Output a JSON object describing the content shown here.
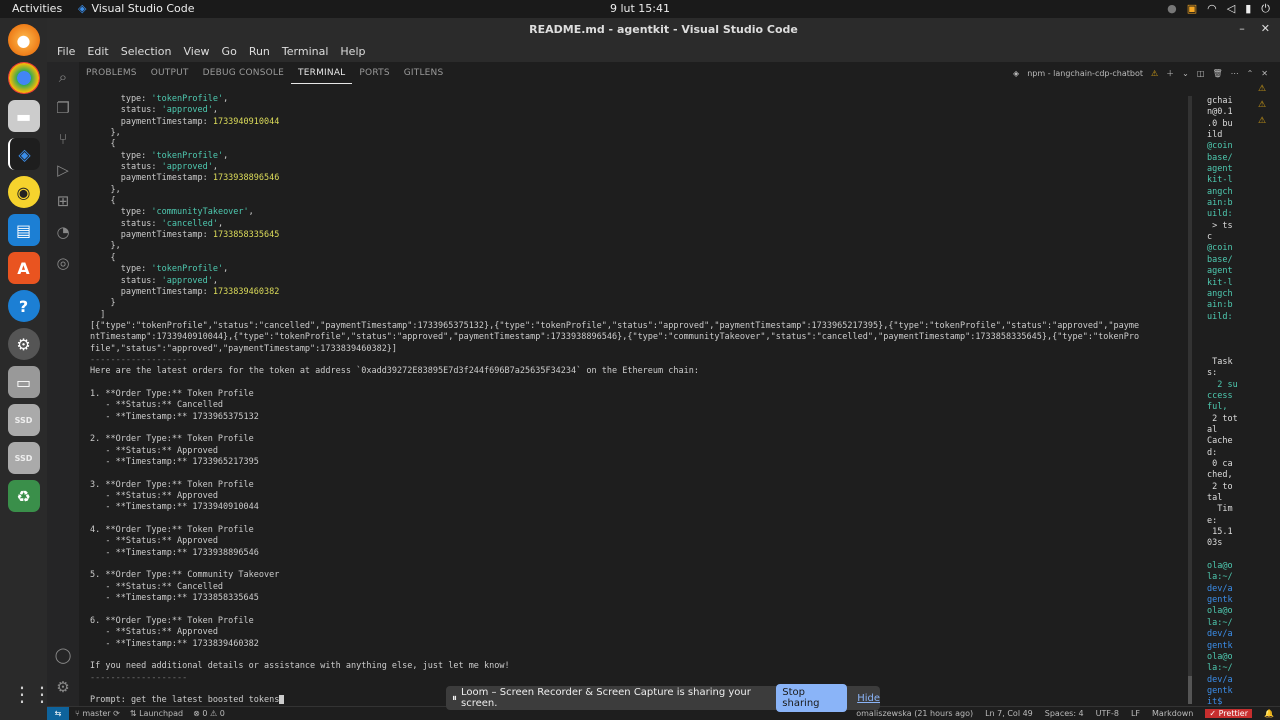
{
  "topbar": {
    "activities": "Activities",
    "app_name": "Visual Studio Code",
    "clock": "9 lut  15:41"
  },
  "window": {
    "title": "README.md - agentkit - Visual Studio Code"
  },
  "menu": [
    "File",
    "Edit",
    "Selection",
    "View",
    "Go",
    "Run",
    "Terminal",
    "Help"
  ],
  "panel": {
    "tabs": [
      "PROBLEMS",
      "OUTPUT",
      "DEBUG CONSOLE",
      "TERMINAL",
      "PORTS",
      "GITLENS"
    ],
    "active_tab": "TERMINAL",
    "terminal_name": "npm - langchain-cdp-chatbot"
  },
  "terminal": {
    "lines": [
      [
        {
          "t": "      type: "
        },
        {
          "t": "'tokenProfile'",
          "c": "str"
        },
        {
          "t": ","
        }
      ],
      [
        {
          "t": "      status: "
        },
        {
          "t": "'approved'",
          "c": "str"
        },
        {
          "t": ","
        }
      ],
      [
        {
          "t": "      paymentTimestamp: "
        },
        {
          "t": "1733940910044",
          "c": "num"
        }
      ],
      [
        {
          "t": "    },"
        }
      ],
      [
        {
          "t": "    {"
        }
      ],
      [
        {
          "t": "      type: "
        },
        {
          "t": "'tokenProfile'",
          "c": "str"
        },
        {
          "t": ","
        }
      ],
      [
        {
          "t": "      status: "
        },
        {
          "t": "'approved'",
          "c": "str"
        },
        {
          "t": ","
        }
      ],
      [
        {
          "t": "      paymentTimestamp: "
        },
        {
          "t": "1733938896546",
          "c": "num"
        }
      ],
      [
        {
          "t": "    },"
        }
      ],
      [
        {
          "t": "    {"
        }
      ],
      [
        {
          "t": "      type: "
        },
        {
          "t": "'communityTakeover'",
          "c": "str"
        },
        {
          "t": ","
        }
      ],
      [
        {
          "t": "      status: "
        },
        {
          "t": "'cancelled'",
          "c": "str"
        },
        {
          "t": ","
        }
      ],
      [
        {
          "t": "      paymentTimestamp: "
        },
        {
          "t": "1733858335645",
          "c": "num"
        }
      ],
      [
        {
          "t": "    },"
        }
      ],
      [
        {
          "t": "    {"
        }
      ],
      [
        {
          "t": "      type: "
        },
        {
          "t": "'tokenProfile'",
          "c": "str"
        },
        {
          "t": ","
        }
      ],
      [
        {
          "t": "      status: "
        },
        {
          "t": "'approved'",
          "c": "str"
        },
        {
          "t": ","
        }
      ],
      [
        {
          "t": "      paymentTimestamp: "
        },
        {
          "t": "1733839460382",
          "c": "num"
        }
      ],
      [
        {
          "t": "    }"
        }
      ],
      [
        {
          "t": "  ]"
        }
      ],
      [
        {
          "t": "[{\"type\":\"tokenProfile\",\"status\":\"cancelled\",\"paymentTimestamp\":1733965375132},{\"type\":\"tokenProfile\",\"status\":\"approved\",\"paymentTimestamp\":1733965217395},{\"type\":\"tokenProfile\",\"status\":\"approved\",\"payme"
        }
      ],
      [
        {
          "t": "ntTimestamp\":1733940910044},{\"type\":\"tokenProfile\",\"status\":\"approved\",\"paymentTimestamp\":1733938896546},{\"type\":\"communityTakeover\",\"status\":\"cancelled\",\"paymentTimestamp\":1733858335645},{\"type\":\"tokenPro"
        }
      ],
      [
        {
          "t": "file\",\"status\":\"approved\",\"paymentTimestamp\":1733839460382}]"
        }
      ],
      [
        {
          "t": "-------------------",
          "c": "dim"
        }
      ],
      [
        {
          "t": "Here are the latest orders for the token at address `0xadd39272E83895E7d3f244f696B7a25635F34234` on the Ethereum chain:"
        }
      ],
      [
        {
          "t": ""
        }
      ],
      [
        {
          "t": "1. **Order Type:** Token Profile"
        }
      ],
      [
        {
          "t": "   - **Status:** Cancelled"
        }
      ],
      [
        {
          "t": "   - **Timestamp:** 1733965375132"
        }
      ],
      [
        {
          "t": ""
        }
      ],
      [
        {
          "t": "2. **Order Type:** Token Profile"
        }
      ],
      [
        {
          "t": "   - **Status:** Approved"
        }
      ],
      [
        {
          "t": "   - **Timestamp:** 1733965217395"
        }
      ],
      [
        {
          "t": ""
        }
      ],
      [
        {
          "t": "3. **Order Type:** Token Profile"
        }
      ],
      [
        {
          "t": "   - **Status:** Approved"
        }
      ],
      [
        {
          "t": "   - **Timestamp:** 1733940910044"
        }
      ],
      [
        {
          "t": ""
        }
      ],
      [
        {
          "t": "4. **Order Type:** Token Profile"
        }
      ],
      [
        {
          "t": "   - **Status:** Approved"
        }
      ],
      [
        {
          "t": "   - **Timestamp:** 1733938896546"
        }
      ],
      [
        {
          "t": ""
        }
      ],
      [
        {
          "t": "5. **Order Type:** Community Takeover"
        }
      ],
      [
        {
          "t": "   - **Status:** Cancelled"
        }
      ],
      [
        {
          "t": "   - **Timestamp:** 1733858335645"
        }
      ],
      [
        {
          "t": ""
        }
      ],
      [
        {
          "t": "6. **Order Type:** Token Profile"
        }
      ],
      [
        {
          "t": "   - **Status:** Approved"
        }
      ],
      [
        {
          "t": "   - **Timestamp:** 1733839460382"
        }
      ],
      [
        {
          "t": ""
        }
      ],
      [
        {
          "t": "If you need additional details or assistance with anything else, just let me know!"
        }
      ],
      [
        {
          "t": "-------------------",
          "c": "dim"
        }
      ],
      [
        {
          "t": ""
        }
      ],
      [
        {
          "t": "Prompt: get the latest boosted tokens"
        }
      ]
    ]
  },
  "side_terminal": {
    "lines": [
      [
        {
          "t": "gchai",
          "c": "w"
        }
      ],
      [
        {
          "t": "n@0.1",
          "c": "w"
        }
      ],
      [
        {
          "t": ".0 bu",
          "c": "w"
        }
      ],
      [
        {
          "t": "ild",
          "c": "w"
        }
      ],
      [
        {
          "t": "@coin",
          "c": "c"
        }
      ],
      [
        {
          "t": "base/",
          "c": "c"
        }
      ],
      [
        {
          "t": "agent",
          "c": "c"
        }
      ],
      [
        {
          "t": "kit-l",
          "c": "c"
        }
      ],
      [
        {
          "t": "angch",
          "c": "c"
        }
      ],
      [
        {
          "t": "ain:b",
          "c": "c"
        }
      ],
      [
        {
          "t": "uild:",
          "c": "c"
        }
      ],
      [
        {
          "t": " > ts",
          "c": "w"
        }
      ],
      [
        {
          "t": "c",
          "c": "w"
        }
      ],
      [
        {
          "t": "@coin",
          "c": "c"
        }
      ],
      [
        {
          "t": "base/",
          "c": "c"
        }
      ],
      [
        {
          "t": "agent",
          "c": "c"
        }
      ],
      [
        {
          "t": "kit-l",
          "c": "c"
        }
      ],
      [
        {
          "t": "angch",
          "c": "c"
        }
      ],
      [
        {
          "t": "ain:b",
          "c": "c"
        }
      ],
      [
        {
          "t": "uild:",
          "c": "c"
        }
      ],
      [
        {
          "t": "",
          "c": "w"
        }
      ],
      [
        {
          "t": "",
          "c": "w"
        }
      ],
      [
        {
          "t": "",
          "c": "w"
        }
      ],
      [
        {
          "t": " Task",
          "c": "w"
        }
      ],
      [
        {
          "t": "s:",
          "c": "w"
        }
      ],
      [
        {
          "t": "  2 su",
          "c": "g"
        }
      ],
      [
        {
          "t": "ccess",
          "c": "g"
        }
      ],
      [
        {
          "t": "ful,",
          "c": "g"
        }
      ],
      [
        {
          "t": " 2 tot",
          "c": "w"
        }
      ],
      [
        {
          "t": "al",
          "c": "w"
        }
      ],
      [
        {
          "t": "Cache",
          "c": "w"
        }
      ],
      [
        {
          "t": "d:",
          "c": "w"
        }
      ],
      [
        {
          "t": " 0 ca",
          "c": "w"
        }
      ],
      [
        {
          "t": "ched,",
          "c": "w"
        }
      ],
      [
        {
          "t": " 2 to",
          "c": "w"
        }
      ],
      [
        {
          "t": "tal",
          "c": "w"
        }
      ],
      [
        {
          "t": "  Tim",
          "c": "w"
        }
      ],
      [
        {
          "t": "e:",
          "c": "w"
        }
      ],
      [
        {
          "t": " 15.1",
          "c": "w"
        }
      ],
      [
        {
          "t": "03s",
          "c": "w"
        }
      ],
      [
        {
          "t": "",
          "c": "w"
        }
      ],
      [
        {
          "t": "ola@o",
          "c": "g"
        }
      ],
      [
        {
          "t": "la:~/",
          "c": "g"
        }
      ],
      [
        {
          "t": "dev/a",
          "c": "b"
        }
      ],
      [
        {
          "t": "gentk",
          "c": "b"
        }
      ],
      [
        {
          "t": "ola@o",
          "c": "g"
        }
      ],
      [
        {
          "t": "la:~/",
          "c": "g"
        }
      ],
      [
        {
          "t": "dev/a",
          "c": "b"
        }
      ],
      [
        {
          "t": "gentk",
          "c": "b"
        }
      ],
      [
        {
          "t": "ola@o",
          "c": "g"
        }
      ],
      [
        {
          "t": "la:~/",
          "c": "g"
        }
      ],
      [
        {
          "t": "dev/a",
          "c": "b"
        }
      ],
      [
        {
          "t": "gentk",
          "c": "b"
        }
      ],
      [
        {
          "t": "it$ ",
          "c": "b"
        }
      ]
    ]
  },
  "statusbar": {
    "branch": "master",
    "launchpad": "Launchpad",
    "problems": "⊗ 0 ⚠ 0",
    "author": "omaliszewska (21 hours ago)",
    "position": "Ln 7, Col 49",
    "spaces": "Spaces: 4",
    "encoding": "UTF-8",
    "eol": "LF",
    "language": "Markdown",
    "prettier": "Prettier"
  },
  "loom": {
    "message": "Loom – Screen Recorder & Screen Capture is sharing your screen.",
    "stop_label": "Stop sharing",
    "hide_label": "Hide"
  }
}
